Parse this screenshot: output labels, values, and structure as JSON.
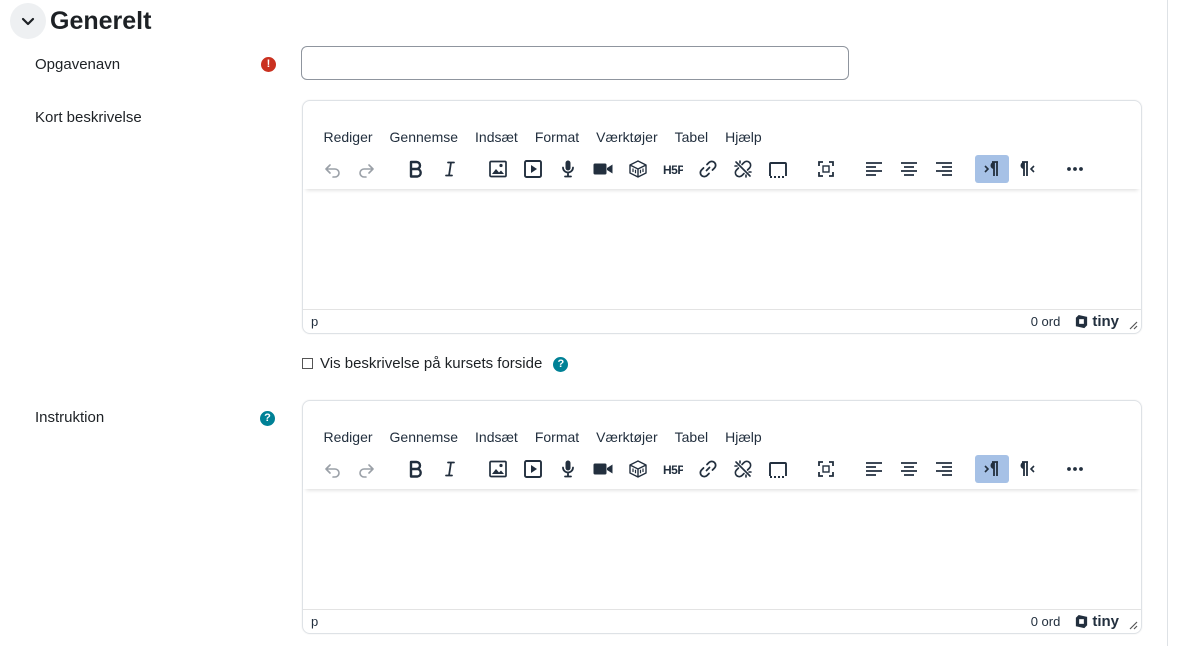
{
  "section": {
    "title": "Generelt"
  },
  "fields": {
    "name": {
      "label": "Opgavenavn",
      "value": "",
      "required_icon": "exclamation-icon"
    },
    "intro": {
      "label": "Kort beskrivelse"
    },
    "show_description": {
      "label": "Vis beskrivelse på kursets forside",
      "checked": false
    },
    "instruction": {
      "label": "Instruktion"
    }
  },
  "help_icon_text": "?",
  "required_icon_text": "!",
  "editor": {
    "menus": [
      "Rediger",
      "Gennemse",
      "Indsæt",
      "Format",
      "Værktøjer",
      "Tabel",
      "Hjælp"
    ],
    "status_path": "p",
    "word_count": "0 ord",
    "brand": "tiny",
    "toolbar_icons": [
      "undo-icon",
      "redo-icon",
      "bold-icon",
      "italic-icon",
      "image-icon",
      "media-icon",
      "record-audio-icon",
      "record-video-icon",
      "embed-icon",
      "h5p-icon",
      "link-icon",
      "unlink-icon",
      "no-autolink-icon",
      "fullscreen-icon",
      "align-left-icon",
      "align-center-icon",
      "align-right-icon",
      "ltr-icon",
      "rtl-icon",
      "more-icon"
    ],
    "active_tool": "ltr-icon"
  },
  "colors": {
    "required": "#ca3120",
    "help": "#008196",
    "active_tool": "#a6c1e6"
  }
}
